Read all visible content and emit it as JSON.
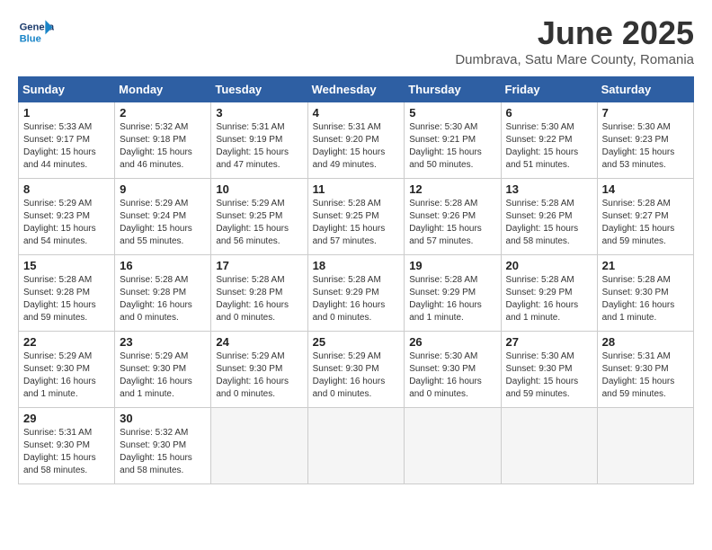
{
  "logo": {
    "line1": "General",
    "line2": "Blue"
  },
  "title": "June 2025",
  "location": "Dumbrava, Satu Mare County, Romania",
  "weekdays": [
    "Sunday",
    "Monday",
    "Tuesday",
    "Wednesday",
    "Thursday",
    "Friday",
    "Saturday"
  ],
  "weeks": [
    [
      {
        "day": "1",
        "info": "Sunrise: 5:33 AM\nSunset: 9:17 PM\nDaylight: 15 hours\nand 44 minutes."
      },
      {
        "day": "2",
        "info": "Sunrise: 5:32 AM\nSunset: 9:18 PM\nDaylight: 15 hours\nand 46 minutes."
      },
      {
        "day": "3",
        "info": "Sunrise: 5:31 AM\nSunset: 9:19 PM\nDaylight: 15 hours\nand 47 minutes."
      },
      {
        "day": "4",
        "info": "Sunrise: 5:31 AM\nSunset: 9:20 PM\nDaylight: 15 hours\nand 49 minutes."
      },
      {
        "day": "5",
        "info": "Sunrise: 5:30 AM\nSunset: 9:21 PM\nDaylight: 15 hours\nand 50 minutes."
      },
      {
        "day": "6",
        "info": "Sunrise: 5:30 AM\nSunset: 9:22 PM\nDaylight: 15 hours\nand 51 minutes."
      },
      {
        "day": "7",
        "info": "Sunrise: 5:30 AM\nSunset: 9:23 PM\nDaylight: 15 hours\nand 53 minutes."
      }
    ],
    [
      {
        "day": "8",
        "info": "Sunrise: 5:29 AM\nSunset: 9:23 PM\nDaylight: 15 hours\nand 54 minutes."
      },
      {
        "day": "9",
        "info": "Sunrise: 5:29 AM\nSunset: 9:24 PM\nDaylight: 15 hours\nand 55 minutes."
      },
      {
        "day": "10",
        "info": "Sunrise: 5:29 AM\nSunset: 9:25 PM\nDaylight: 15 hours\nand 56 minutes."
      },
      {
        "day": "11",
        "info": "Sunrise: 5:28 AM\nSunset: 9:25 PM\nDaylight: 15 hours\nand 57 minutes."
      },
      {
        "day": "12",
        "info": "Sunrise: 5:28 AM\nSunset: 9:26 PM\nDaylight: 15 hours\nand 57 minutes."
      },
      {
        "day": "13",
        "info": "Sunrise: 5:28 AM\nSunset: 9:26 PM\nDaylight: 15 hours\nand 58 minutes."
      },
      {
        "day": "14",
        "info": "Sunrise: 5:28 AM\nSunset: 9:27 PM\nDaylight: 15 hours\nand 59 minutes."
      }
    ],
    [
      {
        "day": "15",
        "info": "Sunrise: 5:28 AM\nSunset: 9:28 PM\nDaylight: 15 hours\nand 59 minutes."
      },
      {
        "day": "16",
        "info": "Sunrise: 5:28 AM\nSunset: 9:28 PM\nDaylight: 16 hours\nand 0 minutes."
      },
      {
        "day": "17",
        "info": "Sunrise: 5:28 AM\nSunset: 9:28 PM\nDaylight: 16 hours\nand 0 minutes."
      },
      {
        "day": "18",
        "info": "Sunrise: 5:28 AM\nSunset: 9:29 PM\nDaylight: 16 hours\nand 0 minutes."
      },
      {
        "day": "19",
        "info": "Sunrise: 5:28 AM\nSunset: 9:29 PM\nDaylight: 16 hours\nand 1 minute."
      },
      {
        "day": "20",
        "info": "Sunrise: 5:28 AM\nSunset: 9:29 PM\nDaylight: 16 hours\nand 1 minute."
      },
      {
        "day": "21",
        "info": "Sunrise: 5:28 AM\nSunset: 9:30 PM\nDaylight: 16 hours\nand 1 minute."
      }
    ],
    [
      {
        "day": "22",
        "info": "Sunrise: 5:29 AM\nSunset: 9:30 PM\nDaylight: 16 hours\nand 1 minute."
      },
      {
        "day": "23",
        "info": "Sunrise: 5:29 AM\nSunset: 9:30 PM\nDaylight: 16 hours\nand 1 minute."
      },
      {
        "day": "24",
        "info": "Sunrise: 5:29 AM\nSunset: 9:30 PM\nDaylight: 16 hours\nand 0 minutes."
      },
      {
        "day": "25",
        "info": "Sunrise: 5:29 AM\nSunset: 9:30 PM\nDaylight: 16 hours\nand 0 minutes."
      },
      {
        "day": "26",
        "info": "Sunrise: 5:30 AM\nSunset: 9:30 PM\nDaylight: 16 hours\nand 0 minutes."
      },
      {
        "day": "27",
        "info": "Sunrise: 5:30 AM\nSunset: 9:30 PM\nDaylight: 15 hours\nand 59 minutes."
      },
      {
        "day": "28",
        "info": "Sunrise: 5:31 AM\nSunset: 9:30 PM\nDaylight: 15 hours\nand 59 minutes."
      }
    ],
    [
      {
        "day": "29",
        "info": "Sunrise: 5:31 AM\nSunset: 9:30 PM\nDaylight: 15 hours\nand 58 minutes."
      },
      {
        "day": "30",
        "info": "Sunrise: 5:32 AM\nSunset: 9:30 PM\nDaylight: 15 hours\nand 58 minutes."
      },
      {
        "day": "",
        "info": ""
      },
      {
        "day": "",
        "info": ""
      },
      {
        "day": "",
        "info": ""
      },
      {
        "day": "",
        "info": ""
      },
      {
        "day": "",
        "info": ""
      }
    ]
  ]
}
